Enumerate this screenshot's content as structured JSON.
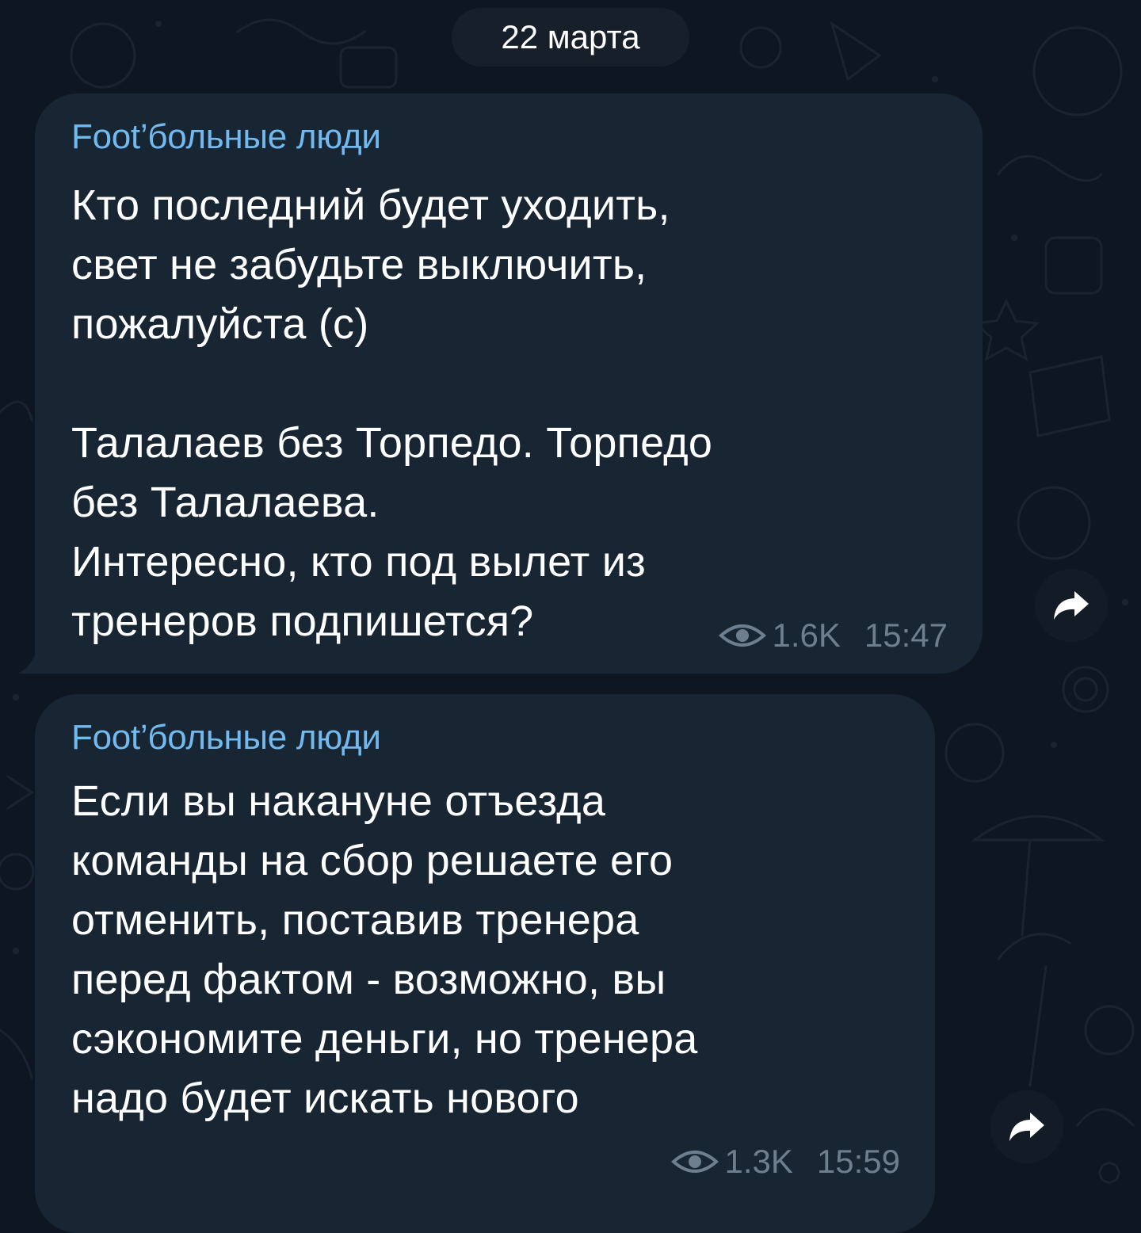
{
  "date_separator": "22 марта",
  "messages": [
    {
      "sender": "Foot’больные люди",
      "lines": [
        "Кто последний будет уходить,",
        "свет не забудьте выключить,",
        "пожалуйста (с)",
        "",
        "Талалаев без Торпедо. Торпедо",
        "без Талалаева.",
        "Интересно, кто под вылет из",
        "тренеров подпишется?"
      ],
      "views": "1.6K",
      "time": "15:47"
    },
    {
      "sender": "Foot’больные люди",
      "lines": [
        "Если вы накануне отъезда",
        "команды на сбор решаете его",
        "отменить, поставив тренера",
        "перед фактом - возможно, вы",
        "сэкономите деньги, но тренера",
        "надо будет искать нового"
      ],
      "views": "1.3K",
      "time": "15:59"
    }
  ],
  "icons": {
    "views": "eye-icon",
    "share": "share-arrow-icon"
  },
  "colors": {
    "background": "#0e1621",
    "bubble": "#182533",
    "sender": "#71b9ee",
    "meta": "#6d7f8f",
    "text": "#ffffff"
  }
}
